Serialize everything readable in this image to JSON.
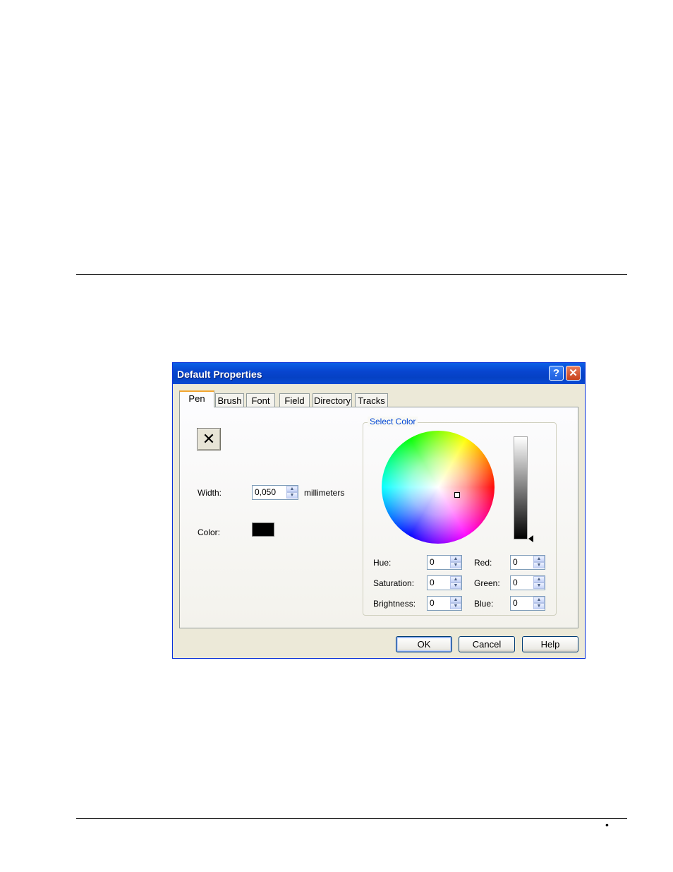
{
  "dialog": {
    "title": "Default Properties",
    "help_button": "?",
    "close_button": "✕"
  },
  "tabs": [
    {
      "label": "Pen",
      "active": true
    },
    {
      "label": "Brush"
    },
    {
      "label": "Font"
    },
    {
      "label": "Field"
    },
    {
      "label": "Directory"
    },
    {
      "label": "Tracks"
    }
  ],
  "pen": {
    "style_button": "✕",
    "width_label": "Width:",
    "width_value": "0,050",
    "width_unit": "millimeters",
    "color_label": "Color:",
    "color_value": "#000000"
  },
  "select_color": {
    "title": "Select Color",
    "hue_label": "Hue:",
    "hue_value": "0",
    "saturation_label": "Saturation:",
    "saturation_value": "0",
    "brightness_label": "Brightness:",
    "brightness_value": "0",
    "red_label": "Red:",
    "red_value": "0",
    "green_label": "Green:",
    "green_value": "0",
    "blue_label": "Blue:",
    "blue_value": "0"
  },
  "buttons": {
    "ok": "OK",
    "cancel": "Cancel",
    "help": "Help"
  },
  "page": {
    "bullet": "•"
  }
}
